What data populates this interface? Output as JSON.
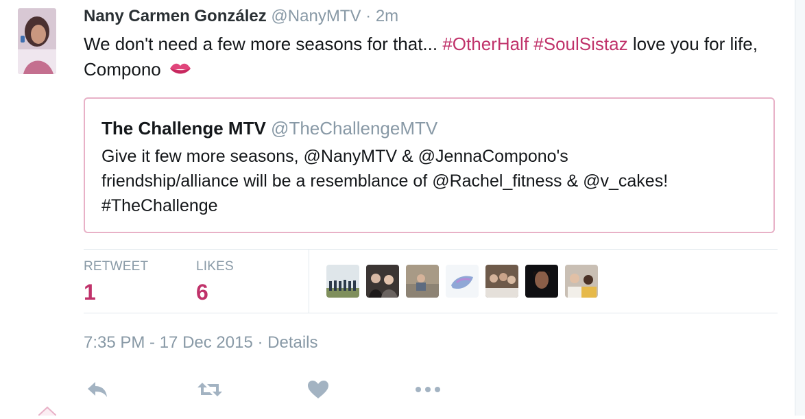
{
  "tweet": {
    "author": {
      "fullname": "Nany Carmen González",
      "username": "@NanyMTV",
      "separator": "·",
      "time_ago": "2m"
    },
    "text_parts": [
      "We don't need a few more seasons for that... ",
      "#OtherHalf",
      " ",
      "#SoulSistaz",
      " love you for life, Compono "
    ],
    "emoji": "kiss-mark-icon"
  },
  "quoted_tweet": {
    "fullname": "The Challenge MTV",
    "username": "@TheChallengeMTV",
    "text_line1": "Give it few more seasons, @NanyMTV & @JennaCompono's",
    "text_line2": "friendship/alliance will be a resemblance of @Rachel_fitness & @v_cakes!",
    "text_line3": "#TheChallenge"
  },
  "stats": {
    "retweets_label": "RETWEET",
    "retweets_count": "1",
    "likes_label": "LIKES",
    "likes_count": "6"
  },
  "likers": [
    "liker-avatar-1",
    "liker-avatar-2",
    "liker-avatar-3",
    "liker-avatar-4",
    "liker-avatar-5",
    "liker-avatar-6",
    "liker-avatar-7"
  ],
  "meta": {
    "timestamp": "7:35 PM - 17 Dec 2015",
    "separator": " · ",
    "details_link": "Details"
  },
  "actions": [
    "reply-icon",
    "retweet-icon",
    "like-icon",
    "more-icon"
  ],
  "colors": {
    "hashtag": "#c0326a",
    "stat_value": "#c0326a",
    "quote_border": "#e8b1c7",
    "muted": "#8899a6"
  }
}
